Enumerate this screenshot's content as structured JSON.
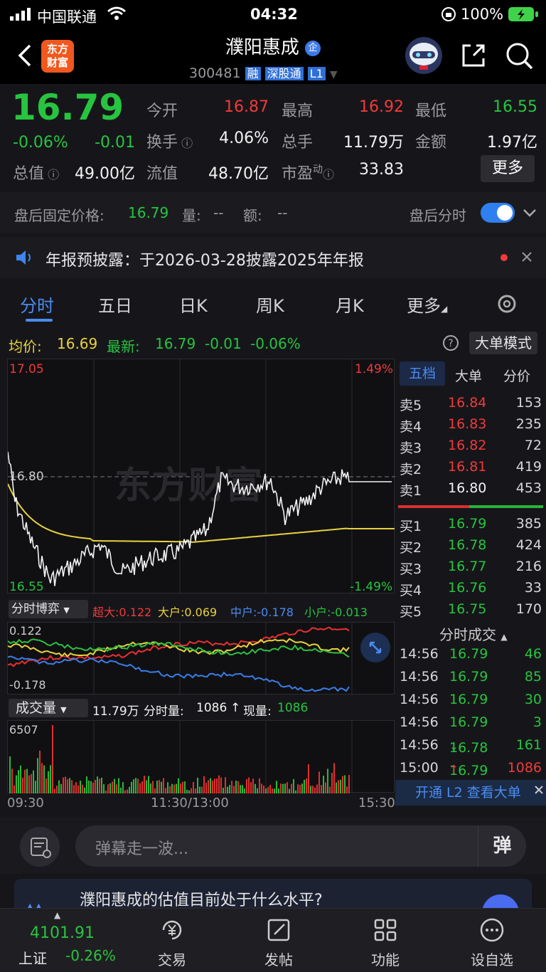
{
  "status_bar": {
    "carrier": "中国联通",
    "time": "04:32",
    "battery": "100%"
  },
  "header": {
    "logo_line1": "东方",
    "logo_line2": "财富",
    "title": "濮阳惠成",
    "title_badge": "企",
    "code": "300481",
    "tags": [
      "融",
      "深股通",
      "L1"
    ]
  },
  "quote": {
    "price": "16.79",
    "change_pct": "-0.06%",
    "change": "-0.01",
    "rows": [
      [
        {
          "label": "今开",
          "value": "16.87",
          "color": "red"
        },
        {
          "label": "最高",
          "value": "16.92",
          "color": "red"
        },
        {
          "label": "最低",
          "value": "16.55",
          "color": "green"
        }
      ],
      [
        {
          "label": "换手",
          "value": "4.06%",
          "color": "white"
        },
        {
          "label": "总手",
          "value": "11.79万",
          "color": "white"
        },
        {
          "label": "金额",
          "value": "1.97亿",
          "color": "white"
        }
      ],
      [
        {
          "label": "流值",
          "value": "48.70亿",
          "color": "white"
        },
        {
          "label": "市盈",
          "sup": "动",
          "value": "33.83",
          "color": "white"
        }
      ]
    ],
    "total_label": "总值",
    "total_value": "49.00亿",
    "more_button": "更多"
  },
  "after_hours": {
    "label": "盘后固定价格:",
    "price": "16.79",
    "qty_label": "量:",
    "qty": "--",
    "amt_label": "额:",
    "amt": "--",
    "toggle_label": "盘后分时",
    "toggle_on": true
  },
  "notice": {
    "text": "年报预披露：于2026-03-28披露2025年年报"
  },
  "tabs": [
    "分时",
    "五日",
    "日K",
    "周K",
    "月K",
    "更多"
  ],
  "active_tab": "分时",
  "info_line": {
    "avg_label": "均价:",
    "avg": "16.69",
    "latest_label": "最新:",
    "latest": "16.79",
    "chg": "-0.01",
    "chg_pct": "-0.06%",
    "mode_button": "大单模式"
  },
  "chart_labels": {
    "top_price": "17.05",
    "mid_price": "16.80",
    "bottom_price": "16.55",
    "top_pct": "1.49%",
    "bottom_pct": "-1.49%",
    "watermark": "东方财富"
  },
  "orderbook": {
    "tabs": [
      "五档",
      "大单",
      "分价"
    ],
    "sells": [
      {
        "label": "卖5",
        "price": "16.84",
        "vol": "153",
        "color": "red"
      },
      {
        "label": "卖4",
        "price": "16.83",
        "vol": "235",
        "color": "red"
      },
      {
        "label": "卖3",
        "price": "16.82",
        "vol": "72",
        "color": "red"
      },
      {
        "label": "卖2",
        "price": "16.81",
        "vol": "419",
        "color": "red"
      },
      {
        "label": "卖1",
        "price": "16.80",
        "vol": "453",
        "color": "white"
      }
    ],
    "buys": [
      {
        "label": "买1",
        "price": "16.79",
        "vol": "385",
        "color": "green"
      },
      {
        "label": "买2",
        "price": "16.78",
        "vol": "424",
        "color": "green"
      },
      {
        "label": "买3",
        "price": "16.77",
        "vol": "216",
        "color": "green"
      },
      {
        "label": "买4",
        "price": "16.76",
        "vol": "33",
        "color": "green"
      },
      {
        "label": "买5",
        "price": "16.75",
        "vol": "170",
        "color": "green"
      }
    ]
  },
  "bof": {
    "title": "分时博弈",
    "super_label": "超大:",
    "super": "0.122",
    "big_label": "大户:",
    "big": "0.069",
    "mid_label": "中户:",
    "mid": "-0.178",
    "small_label": "小户:",
    "small": "-0.013",
    "top": "0.122",
    "bottom": "-0.178"
  },
  "volume": {
    "title": "成交量",
    "total": "11.79万",
    "minute_label": "分时量:",
    "minute": "1086",
    "now_label": "现量:",
    "now": "1086",
    "max": "6507"
  },
  "ticks": {
    "title": "分时成交",
    "rows": [
      {
        "time": "14:56",
        "price": "16.79",
        "vol": "46",
        "arrow": "",
        "color": "green"
      },
      {
        "time": "14:56",
        "price": "16.79",
        "vol": "85",
        "arrow": "",
        "color": "green"
      },
      {
        "time": "14:56",
        "price": "16.79",
        "vol": "30",
        "arrow": "",
        "color": "green"
      },
      {
        "time": "14:56",
        "price": "16.79",
        "vol": "3",
        "arrow": "",
        "color": "green"
      },
      {
        "time": "14:56",
        "price": "16.78",
        "vol": "161",
        "arrow": "↓",
        "color": "green"
      },
      {
        "time": "15:00",
        "price": "16.79",
        "vol": "1086",
        "arrow": "↑",
        "color": "red"
      }
    ],
    "l2_button": "开通 L2 查看大单"
  },
  "time_axis": [
    "09:30",
    "11:30/13:00",
    "15:30"
  ],
  "danmu": {
    "placeholder": "弹幕走一波...",
    "send": "弹"
  },
  "banner": {
    "text": "濮阳惠成的估值目前处于什么水平?"
  },
  "bottom_nav": {
    "index_value": "4101.91",
    "index_name": "上证",
    "index_chg": "-0.26%",
    "items": [
      "交易",
      "发帖",
      "功能",
      "设自选"
    ]
  },
  "colors": {
    "up": "#f03a3a",
    "down": "#27c43f",
    "avg": "#e8d23c",
    "accent": "#2f7ff0"
  }
}
